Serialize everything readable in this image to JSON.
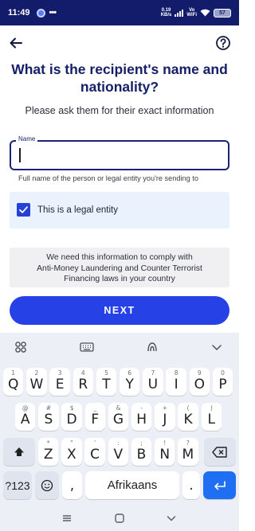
{
  "status_bar": {
    "time": "11:49",
    "dots": "•••",
    "speed_value": "0.19",
    "speed_unit": "KB/s",
    "vo_top": "Vo",
    "vo_bottom": "WiFi",
    "battery": "57"
  },
  "header": {
    "title": "What is the recipient's name and nationality?",
    "subtitle": "Please ask them for their exact information"
  },
  "name_field": {
    "label": "Name",
    "value": "",
    "helper": "Full name of the person or legal entity you're sending to"
  },
  "legal_entity": {
    "label": "This is a legal entity",
    "checked": true
  },
  "info": {
    "line1": "We need this information to comply with",
    "line2": "Anti-Money Laundering and Counter Terrorist",
    "line3": "Financing laws in your country"
  },
  "next_button": "NEXT",
  "keyboard": {
    "row1": [
      {
        "main": "Q",
        "sup": "1"
      },
      {
        "main": "W",
        "sup": "2"
      },
      {
        "main": "E",
        "sup": "3"
      },
      {
        "main": "R",
        "sup": "4"
      },
      {
        "main": "T",
        "sup": "5"
      },
      {
        "main": "Y",
        "sup": "6"
      },
      {
        "main": "U",
        "sup": "7"
      },
      {
        "main": "I",
        "sup": "8"
      },
      {
        "main": "O",
        "sup": "9"
      },
      {
        "main": "P",
        "sup": "0"
      }
    ],
    "row2": [
      {
        "main": "A",
        "sup": "@"
      },
      {
        "main": "S",
        "sup": "#"
      },
      {
        "main": "D",
        "sup": "$"
      },
      {
        "main": "F",
        "sup": "_"
      },
      {
        "main": "G",
        "sup": "&"
      },
      {
        "main": "H",
        "sup": "-"
      },
      {
        "main": "J",
        "sup": "+"
      },
      {
        "main": "K",
        "sup": "("
      },
      {
        "main": "L",
        "sup": ")"
      }
    ],
    "row3": [
      {
        "main": "Z",
        "sup": "*"
      },
      {
        "main": "X",
        "sup": "\""
      },
      {
        "main": "C",
        "sup": "'"
      },
      {
        "main": "V",
        "sup": ":"
      },
      {
        "main": "B",
        "sup": ";"
      },
      {
        "main": "N",
        "sup": "!"
      },
      {
        "main": "M",
        "sup": "?"
      }
    ],
    "symbols_key": "?123",
    "comma_key": ",",
    "space_key": "Afrikaans",
    "period_key": ".",
    "enter_color": "#1e6ff2"
  },
  "colors": {
    "brand": "#131c6b",
    "title": "#162067",
    "accent": "#2641e5",
    "legal_bg": "#e9f2fd"
  },
  "icons": [
    "back-arrow-icon",
    "help-icon",
    "apps-grid-icon",
    "keyboard-icon",
    "gif-icon",
    "collapse-keyboard-icon",
    "shift-icon",
    "backspace-icon",
    "emoji-icon",
    "enter-icon",
    "nav-menu-icon",
    "nav-home-icon",
    "nav-back-icon"
  ]
}
